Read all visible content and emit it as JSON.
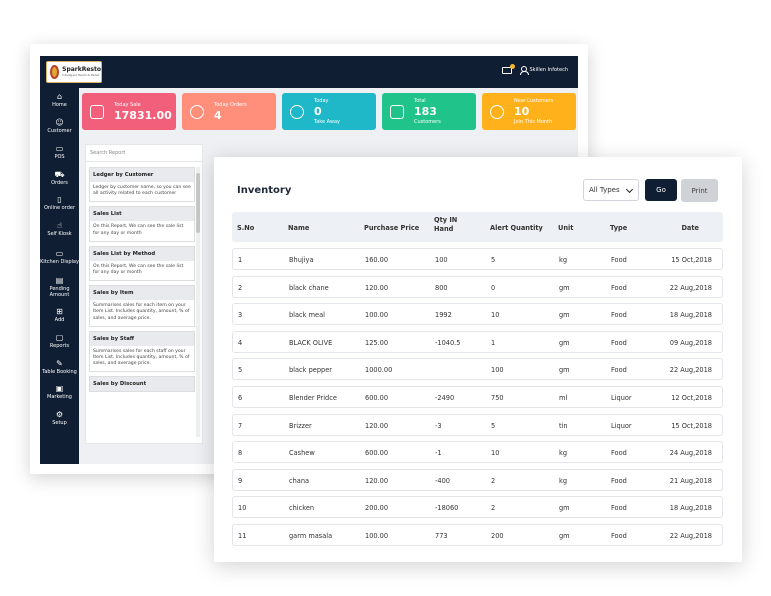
{
  "brand": {
    "name": "SparkResto",
    "tagline": "Intelligent Resto & Retail"
  },
  "topbar": {
    "user_name": "Skillen Infotech",
    "icons": [
      "mail-icon",
      "user-icon"
    ]
  },
  "sidebar": {
    "items": [
      {
        "label": "Home",
        "icon": "home-icon"
      },
      {
        "label": "Customer",
        "icon": "users-icon"
      },
      {
        "label": "POS",
        "icon": "monitor-icon"
      },
      {
        "label": "Orders",
        "icon": "cart-icon"
      },
      {
        "label": "Online order",
        "icon": "phone-icon"
      },
      {
        "label": "Self Kiosk",
        "icon": "touch-icon"
      },
      {
        "label": "Kitchen Display",
        "icon": "display-icon"
      },
      {
        "label": "Pending Amount",
        "icon": "card-icon"
      },
      {
        "label": "Add",
        "icon": "plus-square-icon"
      },
      {
        "label": "Reports",
        "icon": "file-icon"
      },
      {
        "label": "Table Booking",
        "icon": "edit-icon"
      },
      {
        "label": "Marketing",
        "icon": "briefcase-icon"
      },
      {
        "label": "Setup",
        "icon": "gear-icon"
      }
    ]
  },
  "stats": [
    {
      "label": "Today Sale",
      "value": "17831.00",
      "sub": "",
      "color": "#f25f7a",
      "icon": "bag-icon"
    },
    {
      "label": "Today Orders",
      "value": "4",
      "sub": "",
      "color": "#ff8f7a",
      "icon": "gear-icon"
    },
    {
      "label": "Today",
      "value": "0",
      "sub": "Take Away",
      "color": "#1fb8c8",
      "icon": "users-icon"
    },
    {
      "label": "Total",
      "value": "183",
      "sub": "Customers",
      "color": "#20c38a",
      "icon": "archive-icon"
    },
    {
      "label": "New Customers",
      "value": "10",
      "sub": "Join This Month",
      "color": "#ffb11b",
      "icon": "users-icon"
    }
  ],
  "reports": {
    "search_placeholder": "Search Report",
    "items": [
      {
        "title": "Ledger by Customer",
        "desc": "Ledger by customer name, so you can see all activity related to each customer"
      },
      {
        "title": "Sales List",
        "desc": "On this Report, We can see the sale list for any day or month"
      },
      {
        "title": "Sales List by Method",
        "desc": "On this Report, We can see the sale list for any day or month"
      },
      {
        "title": "Sales by Item",
        "desc": "Summarises sales for each item on your Item List. Includes quantity, amount, % of sales, and average price."
      },
      {
        "title": "Sales by Staff",
        "desc": "Summarises sales for each staff on your Item List. Includes quantity, amount, % of sales, and average price."
      },
      {
        "title": "Sales by Discount",
        "desc": ""
      }
    ]
  },
  "inventory": {
    "title": "Inventory",
    "filter_value": "All Types",
    "go_label": "Go",
    "print_label": "Print",
    "columns": [
      "S.No",
      "Name",
      "Purchase Price",
      "Qty IN Hand",
      "Alert Quantity",
      "Unit",
      "Type",
      "Date"
    ],
    "rows": [
      [
        "1",
        "Bhujiya",
        "160.00",
        "100",
        "5",
        "kg",
        "Food",
        "15 Oct,2018"
      ],
      [
        "2",
        "black chane",
        "120.00",
        "800",
        "0",
        "gm",
        "Food",
        "22 Aug,2018"
      ],
      [
        "3",
        "black meal",
        "100.00",
        "1992",
        "10",
        "gm",
        "Food",
        "18 Aug,2018"
      ],
      [
        "4",
        "BLACK OLIVE",
        "125.00",
        "-1040.5",
        "1",
        "gm",
        "Food",
        "09 Aug,2018"
      ],
      [
        "5",
        "black pepper",
        "1000.00",
        "",
        "100",
        "gm",
        "Food",
        "22 Aug,2018"
      ],
      [
        "6",
        "Blender Pridce",
        "600.00",
        "-2490",
        "750",
        "ml",
        "Liquor",
        "12 Oct,2018"
      ],
      [
        "7",
        "Brizzer",
        "120.00",
        "-3",
        "5",
        "tin",
        "Liquor",
        "15 Oct,2018"
      ],
      [
        "8",
        "Cashew",
        "600.00",
        "-1",
        "10",
        "kg",
        "Food",
        "24 Aug,2018"
      ],
      [
        "9",
        "chana",
        "120.00",
        "-400",
        "2",
        "kg",
        "Food",
        "21 Aug,2018"
      ],
      [
        "10",
        "chicken",
        "200.00",
        "-18060",
        "2",
        "gm",
        "Food",
        "18 Aug,2018"
      ],
      [
        "11",
        "garm masala",
        "100.00",
        "773",
        "200",
        "gm",
        "Food",
        "22 Aug,2018"
      ]
    ]
  }
}
